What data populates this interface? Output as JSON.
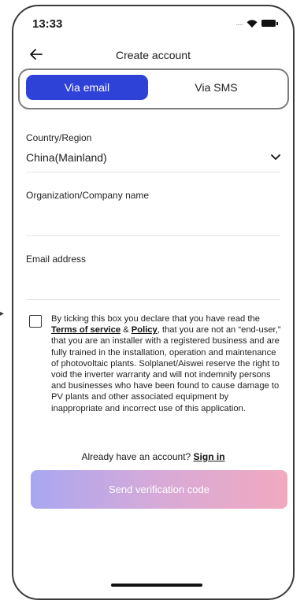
{
  "status": {
    "time": "13:33",
    "signal_text": "....."
  },
  "nav": {
    "title": "Create account"
  },
  "tabs": [
    {
      "label": "Via email",
      "active": true
    },
    {
      "label": "Via SMS",
      "active": false
    }
  ],
  "form": {
    "country_label": "Country/Region",
    "country_value": "China(Mainland)",
    "organization_label": "Organization/Company name",
    "email_label": "Email address"
  },
  "agreement": {
    "part1": "By ticking this box you declare that you have read the ",
    "terms_link": "Terms of service",
    "amp": " & ",
    "policy_link": "Policy",
    "part2": ", that you are not an “end-user,” that you are an installer with a registered business and are fully trained in the installation, operation and maintenance of photovoltaic plants. Solplanet/Aiswei reserve the right to void the inverter warranty and will not indemnify persons and businesses who have been found to cause damage to PV plants and other associated equipment by inappropriate and incorrect use of this application."
  },
  "signin": {
    "prompt": "Already have an account? ",
    "link": "Sign in"
  },
  "send_button": {
    "label": "Send verification code"
  },
  "colors": {
    "accent": "#2f42d8",
    "button_gradient_start": "#a9a7f0",
    "button_gradient_end": "#f1a9bf"
  }
}
